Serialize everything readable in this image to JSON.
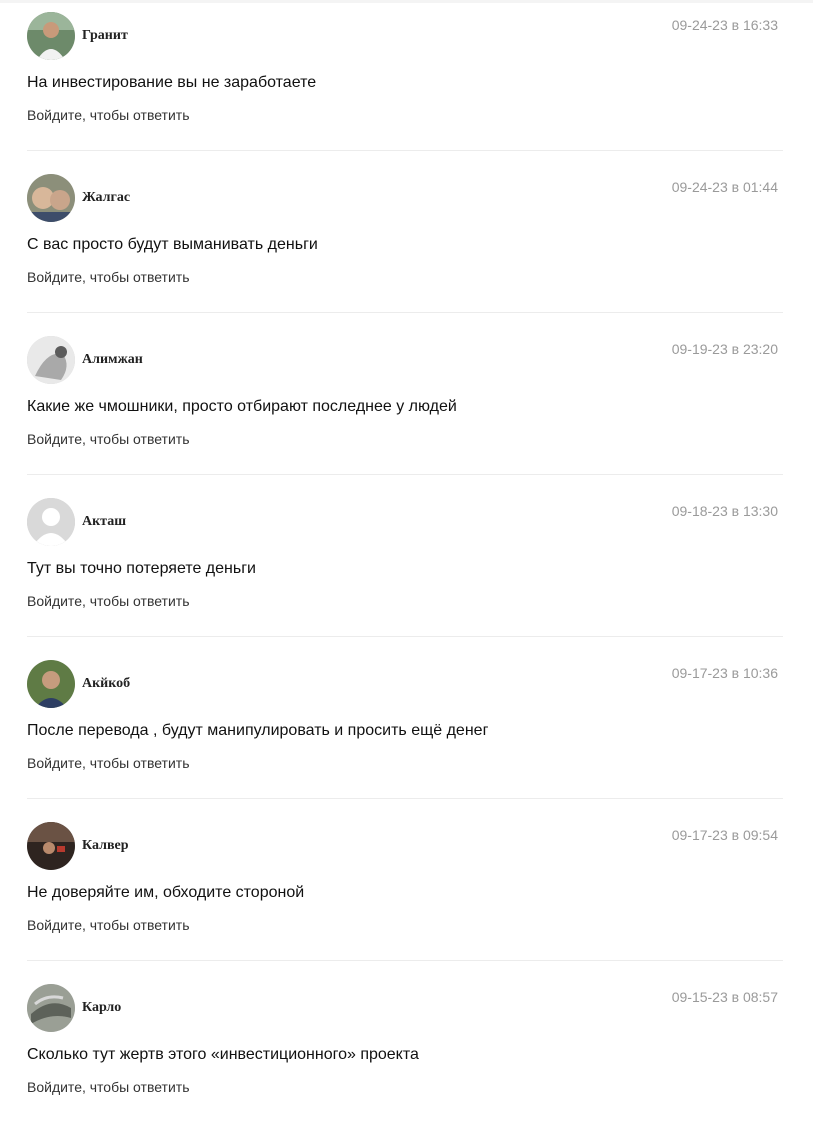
{
  "comments": [
    {
      "author": "Гранит",
      "date": "09-24-23 в 16:33",
      "text": "На инвестирование вы не заработаете",
      "reply": "Войдите, чтобы ответить",
      "avatar_color": "#3b4a52"
    },
    {
      "author": "Жалгас",
      "date": "09-24-23 в 01:44",
      "text": "С вас просто будут выманивать деньги",
      "reply": "Войдите, чтобы ответить",
      "avatar_color": "#7a6a4e"
    },
    {
      "author": "Алимжан",
      "date": "09-19-23 в 23:20",
      "text": "Какие же чмошники, просто отбирают последнее у людей",
      "reply": "Войдите, чтобы ответить",
      "avatar_color": "#bdbdbd"
    },
    {
      "author": "Акташ",
      "date": "09-18-23 в 13:30",
      "text": "Тут вы точно потеряете деньги",
      "reply": "Войдите, чтобы ответить",
      "avatar_color": "#d6d6d6"
    },
    {
      "author": "Акйкоб",
      "date": "09-17-23 в 10:36",
      "text": "После перевода , будут манипулировать и просить ещё денег",
      "reply": "Войдите, чтобы ответить",
      "avatar_color": "#4f6b3a"
    },
    {
      "author": "Калвер",
      "date": "09-17-23 в 09:54",
      "text": "Не доверяйте им, обходите стороной",
      "reply": "Войдите, чтобы ответить",
      "avatar_color": "#5a3d30"
    },
    {
      "author": "Карло",
      "date": "09-15-23 в 08:57",
      "text": "Сколько тут жертв этого «инвестиционного» проекта",
      "reply": "Войдите, чтобы ответить",
      "avatar_color": "#8a8f86"
    }
  ]
}
